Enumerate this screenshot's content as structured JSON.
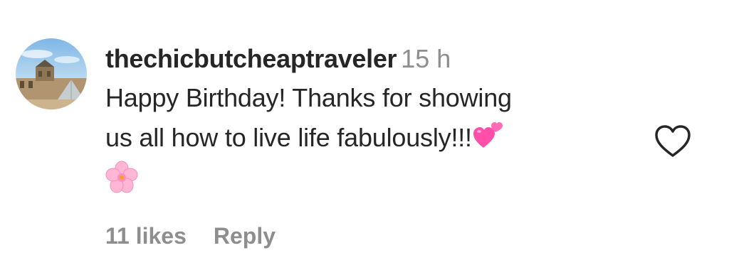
{
  "comment": {
    "username": "thechicbutcheaptraveler",
    "timestamp": "15 h",
    "text_line1": "Happy Birthday! Thanks for showing",
    "text_line2": "us all how to live life fabulously!!!",
    "emojis": [
      "two-hearts-icon",
      "cherry-blossom-icon"
    ],
    "likes": "11 likes",
    "reply_label": "Reply",
    "like_icon": "heart-outline-icon"
  },
  "colors": {
    "text": "#262626",
    "secondary": "#8e8e8e",
    "heart_emoji": "#ff4fa8",
    "blossom": "#ffb7d5"
  }
}
